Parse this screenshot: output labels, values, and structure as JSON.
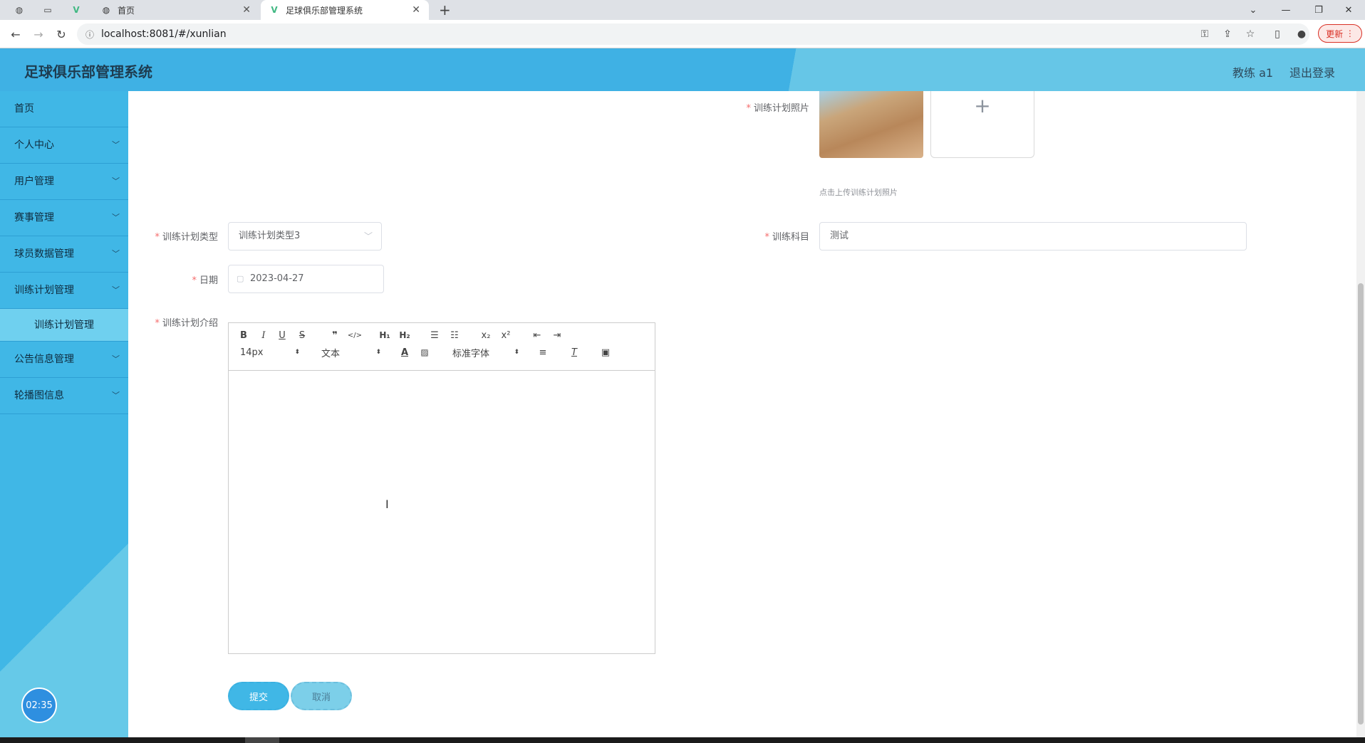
{
  "browser": {
    "tabs": [
      {
        "label": "首页",
        "icon": "globe-icon"
      },
      {
        "label": "足球俱乐部管理系统",
        "icon": "vue-icon"
      }
    ],
    "new_tab": "+",
    "address": "localhost:8081/#/xunlian",
    "update_label": "更新",
    "window_controls": [
      "minimize",
      "restore",
      "close"
    ]
  },
  "app": {
    "title": "足球俱乐部管理系统",
    "user": "教练 a1",
    "logout": "退出登录"
  },
  "sidebar": {
    "items": [
      {
        "label": "首页",
        "expandable": false
      },
      {
        "label": "个人中心",
        "expandable": true
      },
      {
        "label": "用户管理",
        "expandable": true
      },
      {
        "label": "赛事管理",
        "expandable": true
      },
      {
        "label": "球员数据管理",
        "expandable": true
      },
      {
        "label": "训练计划管理",
        "expandable": true
      },
      {
        "label": "训练计划管理",
        "sub": true
      },
      {
        "label": "公告信息管理",
        "expandable": true
      },
      {
        "label": "轮播图信息",
        "expandable": true
      }
    ],
    "clock": "02:35"
  },
  "form": {
    "photo_label": "训练计划照片",
    "photo_hint": "点击上传训练计划照片",
    "type_label": "训练计划类型",
    "type_value": "训练计划类型3",
    "subject_label": "训练科目",
    "subject_value": "测试",
    "date_label": "日期",
    "date_value": "2023-04-27",
    "intro_label": "训练计划介绍",
    "editor": {
      "font_size": "14px",
      "header_select": "文本",
      "font_family": "标准字体",
      "buttons_row1": [
        "B",
        "I",
        "U",
        "S",
        "❞",
        "</>",
        "H1",
        "H2",
        "ol",
        "ul",
        "x₂",
        "x²",
        "outdent",
        "indent"
      ],
      "buttons_row2": [
        "color",
        "background",
        "align",
        "clean",
        "image"
      ]
    },
    "submit_label": "提交",
    "cancel_label": "取消"
  }
}
